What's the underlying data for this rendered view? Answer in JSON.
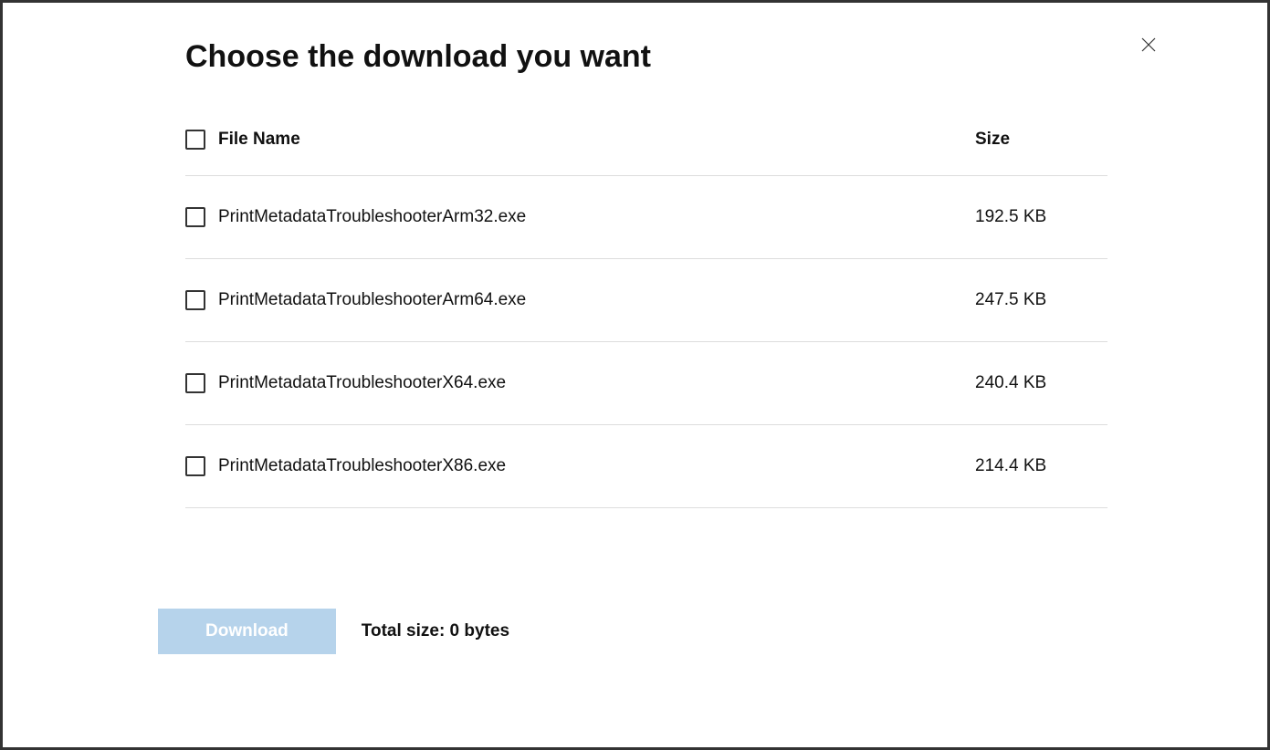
{
  "dialog": {
    "title": "Choose the download you want",
    "columns": {
      "name": "File Name",
      "size": "Size"
    },
    "files": [
      {
        "name": "PrintMetadataTroubleshooterArm32.exe",
        "size": "192.5 KB"
      },
      {
        "name": "PrintMetadataTroubleshooterArm64.exe",
        "size": "247.5 KB"
      },
      {
        "name": "PrintMetadataTroubleshooterX64.exe",
        "size": "240.4 KB"
      },
      {
        "name": "PrintMetadataTroubleshooterX86.exe",
        "size": "214.4 KB"
      }
    ],
    "download_button": "Download",
    "total_size_label": "Total size: 0 bytes"
  }
}
